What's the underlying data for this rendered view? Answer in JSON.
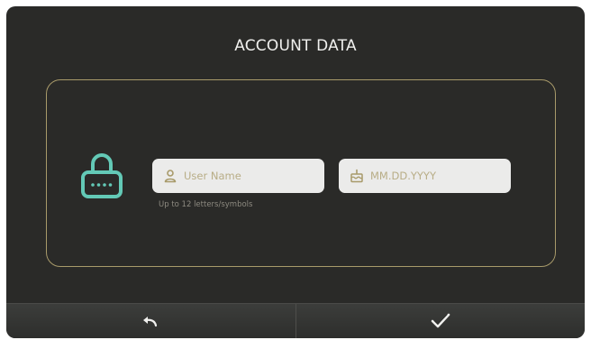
{
  "dialog": {
    "title": "ACCOUNT DATA"
  },
  "form": {
    "username": {
      "placeholder": "User Name",
      "value": "",
      "hint": "Up to 12 letters/symbols",
      "icon": "user-icon"
    },
    "birthdate": {
      "placeholder": "MM.DD.YYYY",
      "value": "",
      "icon": "birthday-cake-icon"
    },
    "lock_icon": "lock-icon"
  },
  "footer": {
    "back_icon": "undo-icon",
    "confirm_icon": "checkmark-icon"
  },
  "colors": {
    "background": "#2a2a28",
    "panel_border": "#a89a6a",
    "accent_teal": "#63c9b6",
    "field_bg": "#ebebea",
    "placeholder_gold": "#b8ad86"
  }
}
